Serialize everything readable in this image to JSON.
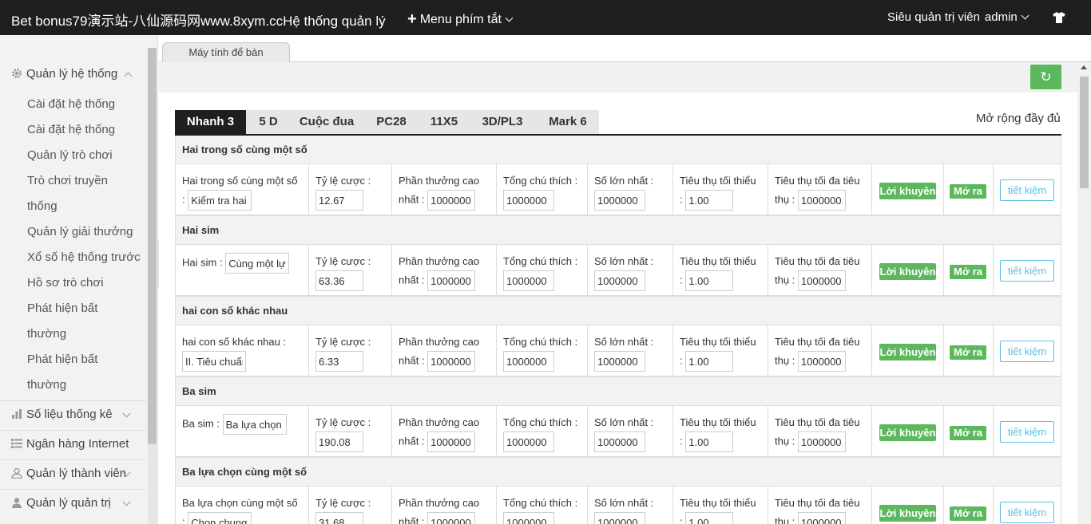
{
  "header": {
    "brand": "Bet bonus79演示站-八仙源码网www.8xym.ccHệ thống quản lý",
    "quick_menu": "Menu phím tắt",
    "role": "Siêu quản trị viên",
    "username": "admin"
  },
  "sidebar": {
    "system_group": "Quản lý hệ thống",
    "system_items": [
      "Cài đặt hệ thống",
      "Cài đặt hệ thống",
      "Quản lý trò chơi",
      "Trò chơi truyền",
      "thống",
      "Quản lý giải thưởng",
      "Xổ số hệ thống trước",
      "Hồ sơ trò chơi",
      "Phát hiện bất",
      "thường",
      "Phát hiện bất",
      "thường"
    ],
    "stats_group": "Số liệu thống kê",
    "bank_group": "Ngân hàng Internet",
    "member_group": "Quản lý thành viên",
    "admin_group": "Quản lý quản trị"
  },
  "page_tab": "Máy tính để bàn",
  "game_tabs": [
    "Nhanh 3",
    "5 D",
    "Cuộc đua",
    "PC28",
    "11X5",
    "3D/PL3",
    "Mark 6"
  ],
  "active_tab": "Nhanh 3",
  "expand_label": "Mở rộng đầy đủ",
  "labels": {
    "odds": "Tỷ lệ cược :",
    "max_prize": "Phần thưởng cao nhất :",
    "total_note": "Tổng chú thích :",
    "max_number": "Số lớn nhất :",
    "min_spend": "Tiêu thụ tối thiểu :",
    "max_spend": "Tiêu thụ tối đa tiêu thụ :",
    "advice": "Lời khuyên",
    "open": "Mở ra",
    "save": "tiết kiệm"
  },
  "sections": [
    {
      "title": "Hai trong số cùng một số",
      "row_label": "Hai trong số cùng một số :",
      "play": "Kiểm tra hai",
      "odds": "12.67",
      "max_prize": "1000000.",
      "total_note": "1000000",
      "max_number": "1000000",
      "min_spend": "1.00",
      "max_spend": "1000000."
    },
    {
      "title": "Hai sim",
      "row_label": "Hai sim :",
      "play": "Cùng một lựa",
      "odds": "63.36",
      "max_prize": "1000000.",
      "total_note": "1000000",
      "max_number": "1000000",
      "min_spend": "1.00",
      "max_spend": "1000000."
    },
    {
      "title": "hai con số khác nhau",
      "row_label": "hai con số khác nhau :",
      "play": "II. Tiêu chuẩn",
      "odds": "6.33",
      "max_prize": "1000000.",
      "total_note": "1000000",
      "max_number": "1000000",
      "min_spend": "1.00",
      "max_spend": "1000000."
    },
    {
      "title": "Ba sim",
      "row_label": "Ba sim :",
      "play": "Ba lựa chọn s",
      "odds": "190.08",
      "max_prize": "1000000.",
      "total_note": "1000000",
      "max_number": "1000000",
      "min_spend": "1.00",
      "max_spend": "1000000."
    },
    {
      "title": "Ba lựa chọn cùng một số",
      "row_label": "Ba lựa chọn cùng một số :",
      "play": "Chọn chung",
      "odds": "31.68",
      "max_prize": "1000000",
      "total_note": "1000000",
      "max_number": "1000000",
      "min_spend": "1.00",
      "max_spend": "1000000."
    }
  ]
}
